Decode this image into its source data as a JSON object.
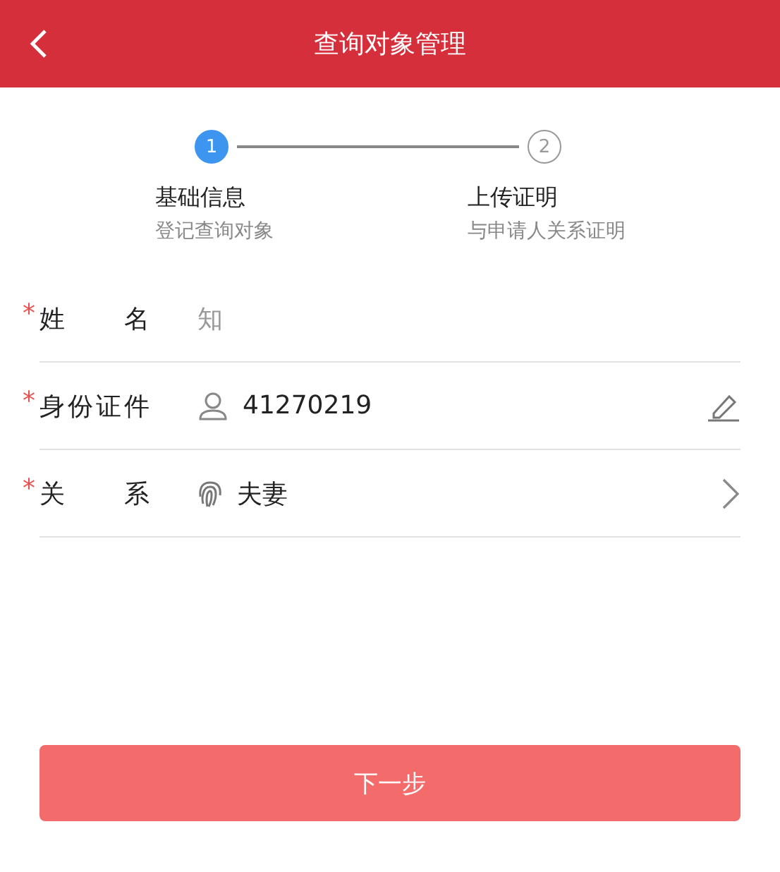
{
  "header": {
    "title": "查询对象管理"
  },
  "steps": [
    {
      "number": "1",
      "title": "基础信息",
      "subtitle": "登记查询对象",
      "selected": true
    },
    {
      "number": "2",
      "title": "上传证明",
      "subtitle": "与申请人关系证明",
      "selected": false
    }
  ],
  "fields": [
    {
      "label": "姓名",
      "required_mark": "*",
      "kind": "text",
      "value": "知",
      "muted": true
    },
    {
      "label": "身份证件",
      "required_mark": "*",
      "kind": "id",
      "value": "41270219",
      "muted": false
    },
    {
      "label": "关系",
      "required_mark": "*",
      "kind": "select",
      "value": "夫妻",
      "muted": false
    }
  ],
  "next_button": "下一步"
}
